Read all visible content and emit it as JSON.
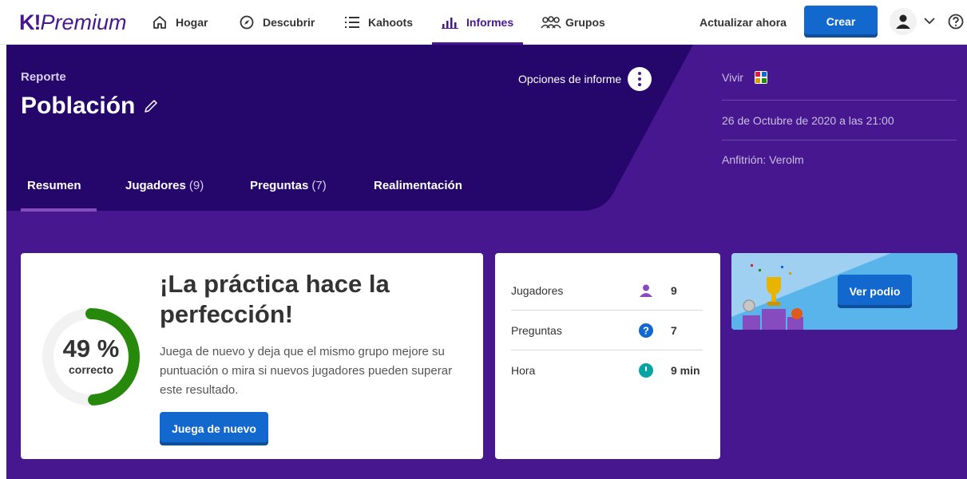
{
  "nav": {
    "logo_k": "K!",
    "logo_text": "Premium",
    "items": [
      {
        "label": "Hogar",
        "icon": "home-icon"
      },
      {
        "label": "Descubrir",
        "icon": "compass-icon"
      },
      {
        "label": "Kahoots",
        "icon": "list-icon"
      },
      {
        "label": "Informes",
        "icon": "chart-icon"
      },
      {
        "label": "Grupos",
        "icon": "group-icon"
      }
    ],
    "active": "Informes",
    "upgrade": "Actualizar ahora",
    "create": "Crear"
  },
  "report": {
    "kicker": "Reporte",
    "title": "Población",
    "options": "Opciones de informe",
    "mode": "Vivir",
    "date": "26 de Octubre de 2020 a las 21:00",
    "host": "Anfitrión: Verolm"
  },
  "tabs": [
    {
      "label": "Resumen",
      "count": ""
    },
    {
      "label": "Jugadores",
      "count": "(9)"
    },
    {
      "label": "Preguntas",
      "count": "(7)"
    },
    {
      "label": "Realimentación",
      "count": ""
    }
  ],
  "summary": {
    "percent": 49,
    "percent_text": "49 %",
    "percent_label": "correcto",
    "headline": "¡La práctica hace la perfección!",
    "description": "Juega de nuevo y deja que el mismo grupo mejore su puntuación o mira si nuevos jugadores pueden superar este resultado.",
    "play_again": "Juega de nuevo"
  },
  "stats": [
    {
      "label": "Jugadores",
      "value": "9",
      "icon": "player-icon"
    },
    {
      "label": "Preguntas",
      "value": "7",
      "icon": "question-icon"
    },
    {
      "label": "Hora",
      "value": "9 min",
      "icon": "clock-icon"
    }
  ],
  "podium": {
    "button": "Ver podio"
  },
  "colors": {
    "brand_purple": "#46178f",
    "primary_blue": "#1368ce",
    "progress_green": "#26890c",
    "ring_track": "#f2f2f2"
  }
}
